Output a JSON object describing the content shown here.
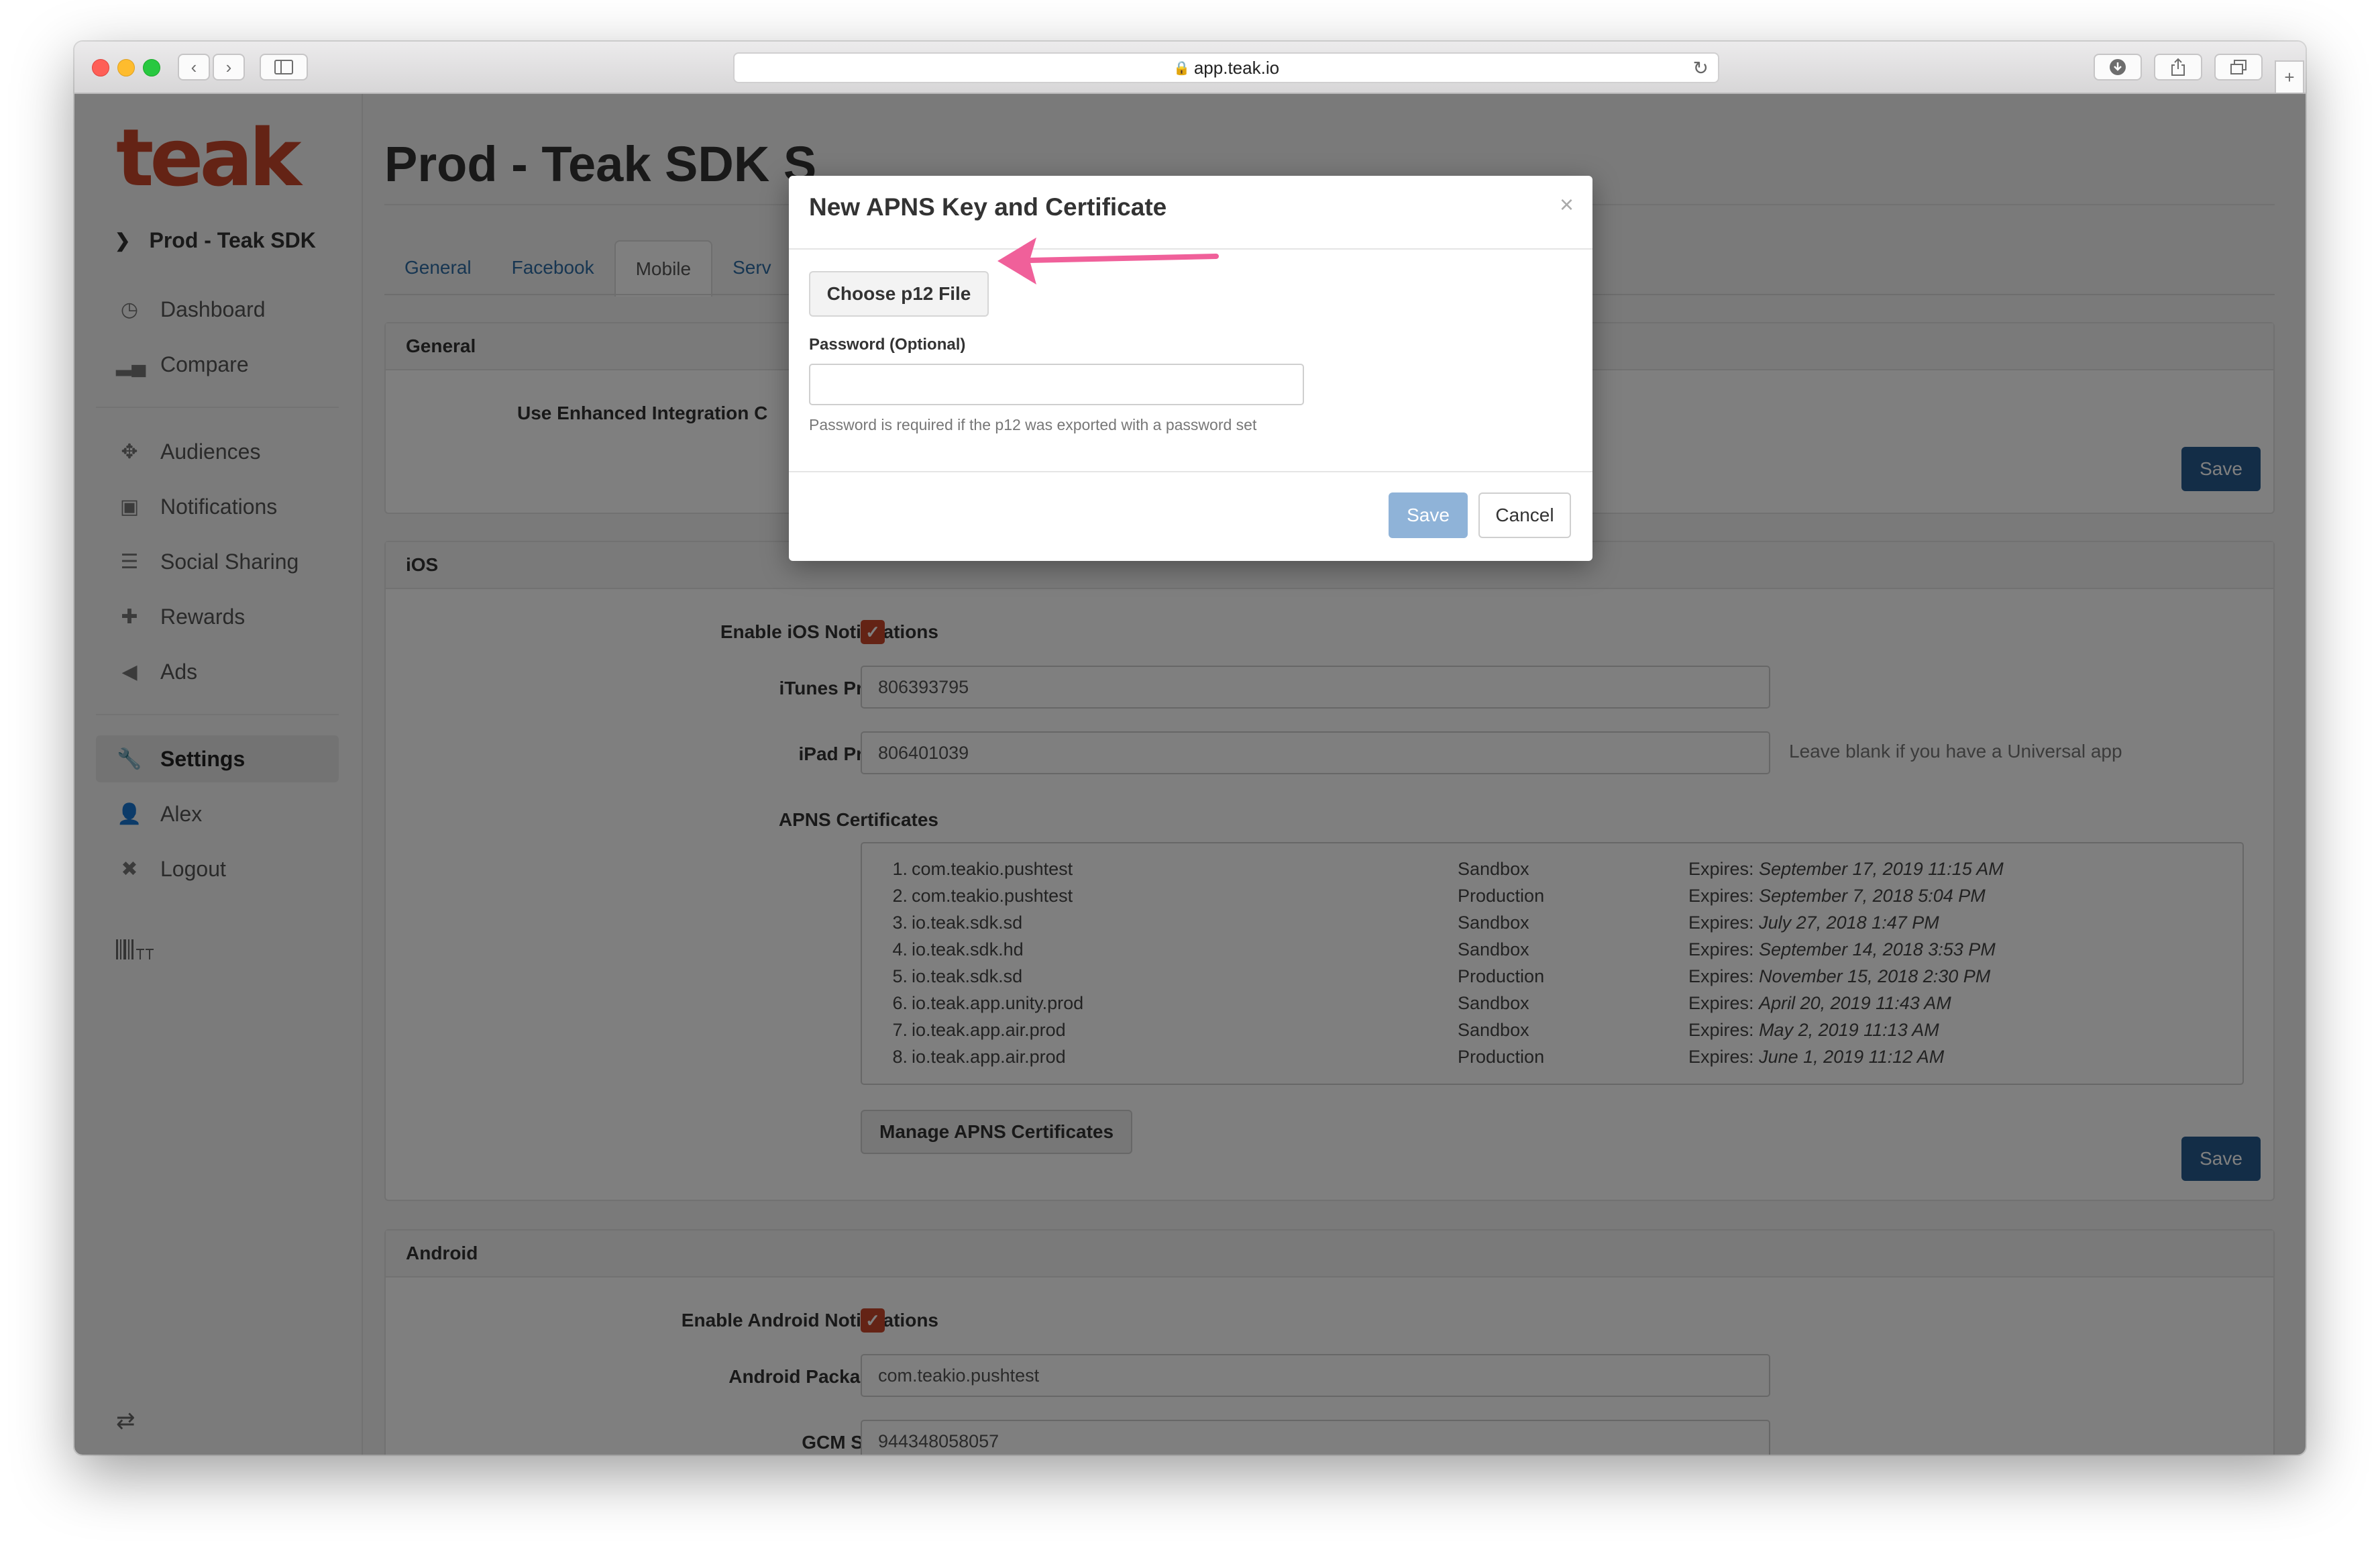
{
  "browser": {
    "url": "app.teak.io"
  },
  "sidebar": {
    "logo": "teak",
    "app_name": "Prod - Teak SDK",
    "items": [
      {
        "label": "Dashboard",
        "icon": "dashboard-icon"
      },
      {
        "label": "Compare",
        "icon": "bar-chart-icon"
      },
      {
        "label": "Audiences",
        "icon": "crosshair-icon"
      },
      {
        "label": "Notifications",
        "icon": "inbox-icon"
      },
      {
        "label": "Social Sharing",
        "icon": "list-icon"
      },
      {
        "label": "Rewards",
        "icon": "gift-icon"
      },
      {
        "label": "Ads",
        "icon": "megaphone-icon"
      },
      {
        "label": "Settings",
        "icon": "wrench-icon",
        "active": true
      },
      {
        "label": "Alex",
        "icon": "user-icon"
      },
      {
        "label": "Logout",
        "icon": "close-icon"
      }
    ]
  },
  "main": {
    "title": "Prod - Teak SDK S",
    "tabs": [
      "General",
      "Facebook",
      "Mobile",
      "Serv"
    ],
    "active_tab": "Mobile",
    "general": {
      "header": "General",
      "enhanced_label": "Use Enhanced Integration C",
      "save_label": "Save"
    },
    "ios": {
      "header": "iOS",
      "enable_label": "Enable iOS Notifications",
      "enabled": true,
      "itunes_label": "iTunes Product ID",
      "itunes_value": "806393795",
      "ipad_label": "iPad Product ID",
      "ipad_value": "806401039",
      "ipad_hint": "Leave blank if you have a Universal app",
      "apns_label": "APNS Certificates",
      "certificates": [
        {
          "num": "1.",
          "bundle": "com.teakio.pushtest",
          "env": "Sandbox",
          "expires_prefix": "Expires:",
          "expires": "September 17, 2019 11:15 AM"
        },
        {
          "num": "2.",
          "bundle": "com.teakio.pushtest",
          "env": "Production",
          "expires_prefix": "Expires:",
          "expires": "September 7, 2018 5:04 PM"
        },
        {
          "num": "3.",
          "bundle": "io.teak.sdk.sd",
          "env": "Sandbox",
          "expires_prefix": "Expires:",
          "expires": "July 27, 2018 1:47 PM"
        },
        {
          "num": "4.",
          "bundle": "io.teak.sdk.hd",
          "env": "Sandbox",
          "expires_prefix": "Expires:",
          "expires": "September 14, 2018 3:53 PM"
        },
        {
          "num": "5.",
          "bundle": "io.teak.sdk.sd",
          "env": "Production",
          "expires_prefix": "Expires:",
          "expires": "November 15, 2018 2:30 PM"
        },
        {
          "num": "6.",
          "bundle": "io.teak.app.unity.prod",
          "env": "Sandbox",
          "expires_prefix": "Expires:",
          "expires": "April 20, 2019 11:43 AM"
        },
        {
          "num": "7.",
          "bundle": "io.teak.app.air.prod",
          "env": "Sandbox",
          "expires_prefix": "Expires:",
          "expires": "May 2, 2019 11:13 AM"
        },
        {
          "num": "8.",
          "bundle": "io.teak.app.air.prod",
          "env": "Production",
          "expires_prefix": "Expires:",
          "expires": "June 1, 2019 11:12 AM"
        }
      ],
      "manage_label": "Manage APNS Certificates",
      "save_label": "Save"
    },
    "android": {
      "header": "Android",
      "enable_label": "Enable Android Notifications",
      "enabled": true,
      "package_label": "Android Package Name",
      "package_value": "com.teakio.pushtest",
      "gcm_label": "GCM Sender ID",
      "gcm_value": "944348058057"
    }
  },
  "modal": {
    "title": "New APNS Key and Certificate",
    "close_symbol": "×",
    "choose_label": "Choose p12 File",
    "password_label": "Password (Optional)",
    "password_value": "",
    "password_help": "Password is required if the p12 was exported with a password set",
    "save_label": "Save",
    "cancel_label": "Cancel"
  },
  "colors": {
    "brand": "#c9462a",
    "primary_button": "#275a8e",
    "link": "#2f6da5",
    "annotation_arrow": "#f0609a"
  }
}
